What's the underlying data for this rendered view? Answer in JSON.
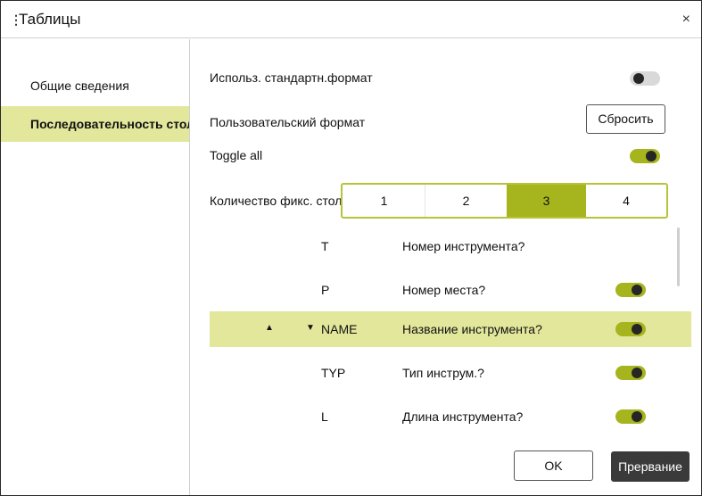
{
  "dialog": {
    "title_dots": "⋮",
    "title": "Таблицы",
    "close_icon": "×"
  },
  "sidebar": {
    "items": [
      {
        "label": "Общие сведения",
        "active": false
      },
      {
        "label": "Последовательность столбцов",
        "active": true
      }
    ]
  },
  "settings": {
    "use_standard_format_label": "Использ. стандартн.формат",
    "use_standard_format_on": false,
    "custom_format_label": "Пользовательский формат",
    "reset_label": "Сбросить",
    "toggle_all_label": "Toggle all",
    "toggle_all_on": true,
    "fixed_columns_label": "Количество фикс. столбцов",
    "fixed_columns_options": [
      "1",
      "2",
      "3",
      "4"
    ],
    "fixed_columns_selected": "3"
  },
  "columns": [
    {
      "code": "T",
      "desc": "Номер инструмента?",
      "toggle": null,
      "highlight": false
    },
    {
      "code": "P",
      "desc": "Номер места?",
      "toggle": true,
      "highlight": false
    },
    {
      "code": "NAME",
      "desc": "Название инструмента?",
      "toggle": true,
      "highlight": true,
      "up_icon": "▲",
      "down_icon": "▼"
    },
    {
      "code": "TYP",
      "desc": "Тип инструм.?",
      "toggle": true,
      "highlight": false
    },
    {
      "code": "L",
      "desc": "Длина инструмента?",
      "toggle": true,
      "highlight": false
    }
  ],
  "footer": {
    "ok_label": "OK",
    "cancel_label": "Прервание"
  },
  "colors": {
    "accent": "#a6b41d",
    "highlight": "#e2e79b",
    "dark_button": "#3a3a3a"
  }
}
